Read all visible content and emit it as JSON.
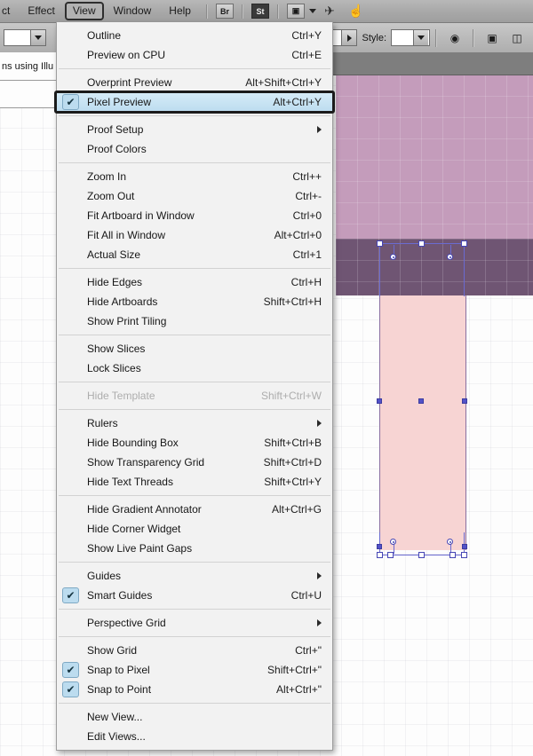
{
  "app": {
    "menu_bar": [
      {
        "label": "ct",
        "active": false,
        "clipped": true
      },
      {
        "label": "Effect",
        "active": false
      },
      {
        "label": "View",
        "active": true
      },
      {
        "label": "Window",
        "active": false
      },
      {
        "label": "Help",
        "active": false
      }
    ],
    "toolbar_icons": [
      {
        "name": "bridge-icon",
        "glyph": "Br"
      },
      {
        "name": "stock-icon",
        "glyph": "St"
      },
      {
        "name": "arrange-documents-icon",
        "glyph": "▣"
      },
      {
        "name": "workspace-switcher-icon",
        "glyph": "▸"
      },
      {
        "name": "search-adobe-stock-icon",
        "glyph": "✈"
      },
      {
        "name": "hand-cursor-icon",
        "glyph": "☝"
      }
    ]
  },
  "control_bar": {
    "style_label": "Style:",
    "swatch_color": "#ffffff",
    "opacity_icon": "opacity-icon",
    "align_icon": "align-icon",
    "document-setup_icon": "document-setup-icon"
  },
  "document_tab": {
    "title": "ns using Illu",
    "close_label": "×"
  },
  "canvas": {
    "artboard_upper_color": "#c49cbb",
    "artboard_band_color": "#6f5573",
    "shape_fill_color": "#f7d4d3",
    "shape_stroke_color": "#8a6fa0",
    "selection_color": "#5252c8"
  },
  "view_menu": {
    "title": "View",
    "items": [
      {
        "type": "item",
        "label": "Outline",
        "accel": "Ctrl+Y",
        "checked": false,
        "disabled": false,
        "submenu": false
      },
      {
        "type": "item",
        "label": "Preview on CPU",
        "accel": "Ctrl+E",
        "checked": false,
        "disabled": false,
        "submenu": false
      },
      {
        "type": "sep"
      },
      {
        "type": "item",
        "label": "Overprint Preview",
        "accel": "Alt+Shift+Ctrl+Y",
        "checked": false,
        "disabled": false,
        "submenu": false
      },
      {
        "type": "item",
        "label": "Pixel Preview",
        "accel": "Alt+Ctrl+Y",
        "checked": true,
        "disabled": false,
        "submenu": false,
        "highlight": true
      },
      {
        "type": "sep"
      },
      {
        "type": "item",
        "label": "Proof Setup",
        "accel": "",
        "checked": false,
        "disabled": false,
        "submenu": true
      },
      {
        "type": "item",
        "label": "Proof Colors",
        "accel": "",
        "checked": false,
        "disabled": false,
        "submenu": false
      },
      {
        "type": "sep"
      },
      {
        "type": "item",
        "label": "Zoom In",
        "accel": "Ctrl++",
        "checked": false,
        "disabled": false,
        "submenu": false
      },
      {
        "type": "item",
        "label": "Zoom Out",
        "accel": "Ctrl+-",
        "checked": false,
        "disabled": false,
        "submenu": false
      },
      {
        "type": "item",
        "label": "Fit Artboard in Window",
        "accel": "Ctrl+0",
        "checked": false,
        "disabled": false,
        "submenu": false
      },
      {
        "type": "item",
        "label": "Fit All in Window",
        "accel": "Alt+Ctrl+0",
        "checked": false,
        "disabled": false,
        "submenu": false
      },
      {
        "type": "item",
        "label": "Actual Size",
        "accel": "Ctrl+1",
        "checked": false,
        "disabled": false,
        "submenu": false
      },
      {
        "type": "sep"
      },
      {
        "type": "item",
        "label": "Hide Edges",
        "accel": "Ctrl+H",
        "checked": false,
        "disabled": false,
        "submenu": false
      },
      {
        "type": "item",
        "label": "Hide Artboards",
        "accel": "Shift+Ctrl+H",
        "checked": false,
        "disabled": false,
        "submenu": false
      },
      {
        "type": "item",
        "label": "Show Print Tiling",
        "accel": "",
        "checked": false,
        "disabled": false,
        "submenu": false
      },
      {
        "type": "sep"
      },
      {
        "type": "item",
        "label": "Show Slices",
        "accel": "",
        "checked": false,
        "disabled": false,
        "submenu": false
      },
      {
        "type": "item",
        "label": "Lock Slices",
        "accel": "",
        "checked": false,
        "disabled": false,
        "submenu": false
      },
      {
        "type": "sep"
      },
      {
        "type": "item",
        "label": "Hide Template",
        "accel": "Shift+Ctrl+W",
        "checked": false,
        "disabled": true,
        "submenu": false
      },
      {
        "type": "sep"
      },
      {
        "type": "item",
        "label": "Rulers",
        "accel": "",
        "checked": false,
        "disabled": false,
        "submenu": true
      },
      {
        "type": "item",
        "label": "Hide Bounding Box",
        "accel": "Shift+Ctrl+B",
        "checked": false,
        "disabled": false,
        "submenu": false
      },
      {
        "type": "item",
        "label": "Show Transparency Grid",
        "accel": "Shift+Ctrl+D",
        "checked": false,
        "disabled": false,
        "submenu": false
      },
      {
        "type": "item",
        "label": "Hide Text Threads",
        "accel": "Shift+Ctrl+Y",
        "checked": false,
        "disabled": false,
        "submenu": false
      },
      {
        "type": "sep"
      },
      {
        "type": "item",
        "label": "Hide Gradient Annotator",
        "accel": "Alt+Ctrl+G",
        "checked": false,
        "disabled": false,
        "submenu": false
      },
      {
        "type": "item",
        "label": "Hide Corner Widget",
        "accel": "",
        "checked": false,
        "disabled": false,
        "submenu": false
      },
      {
        "type": "item",
        "label": "Show Live Paint Gaps",
        "accel": "",
        "checked": false,
        "disabled": false,
        "submenu": false
      },
      {
        "type": "sep"
      },
      {
        "type": "item",
        "label": "Guides",
        "accel": "",
        "checked": false,
        "disabled": false,
        "submenu": true
      },
      {
        "type": "item",
        "label": "Smart Guides",
        "accel": "Ctrl+U",
        "checked": true,
        "disabled": false,
        "submenu": false
      },
      {
        "type": "sep"
      },
      {
        "type": "item",
        "label": "Perspective Grid",
        "accel": "",
        "checked": false,
        "disabled": false,
        "submenu": true
      },
      {
        "type": "sep"
      },
      {
        "type": "item",
        "label": "Show Grid",
        "accel": "Ctrl+\"",
        "checked": false,
        "disabled": false,
        "submenu": false
      },
      {
        "type": "item",
        "label": "Snap to Pixel",
        "accel": "Shift+Ctrl+\"",
        "checked": true,
        "disabled": false,
        "submenu": false
      },
      {
        "type": "item",
        "label": "Snap to Point",
        "accel": "Alt+Ctrl+\"",
        "checked": true,
        "disabled": false,
        "submenu": false
      },
      {
        "type": "sep"
      },
      {
        "type": "item",
        "label": "New View...",
        "accel": "",
        "checked": false,
        "disabled": false,
        "submenu": false
      },
      {
        "type": "item",
        "label": "Edit Views...",
        "accel": "",
        "checked": false,
        "disabled": false,
        "submenu": false
      }
    ]
  }
}
